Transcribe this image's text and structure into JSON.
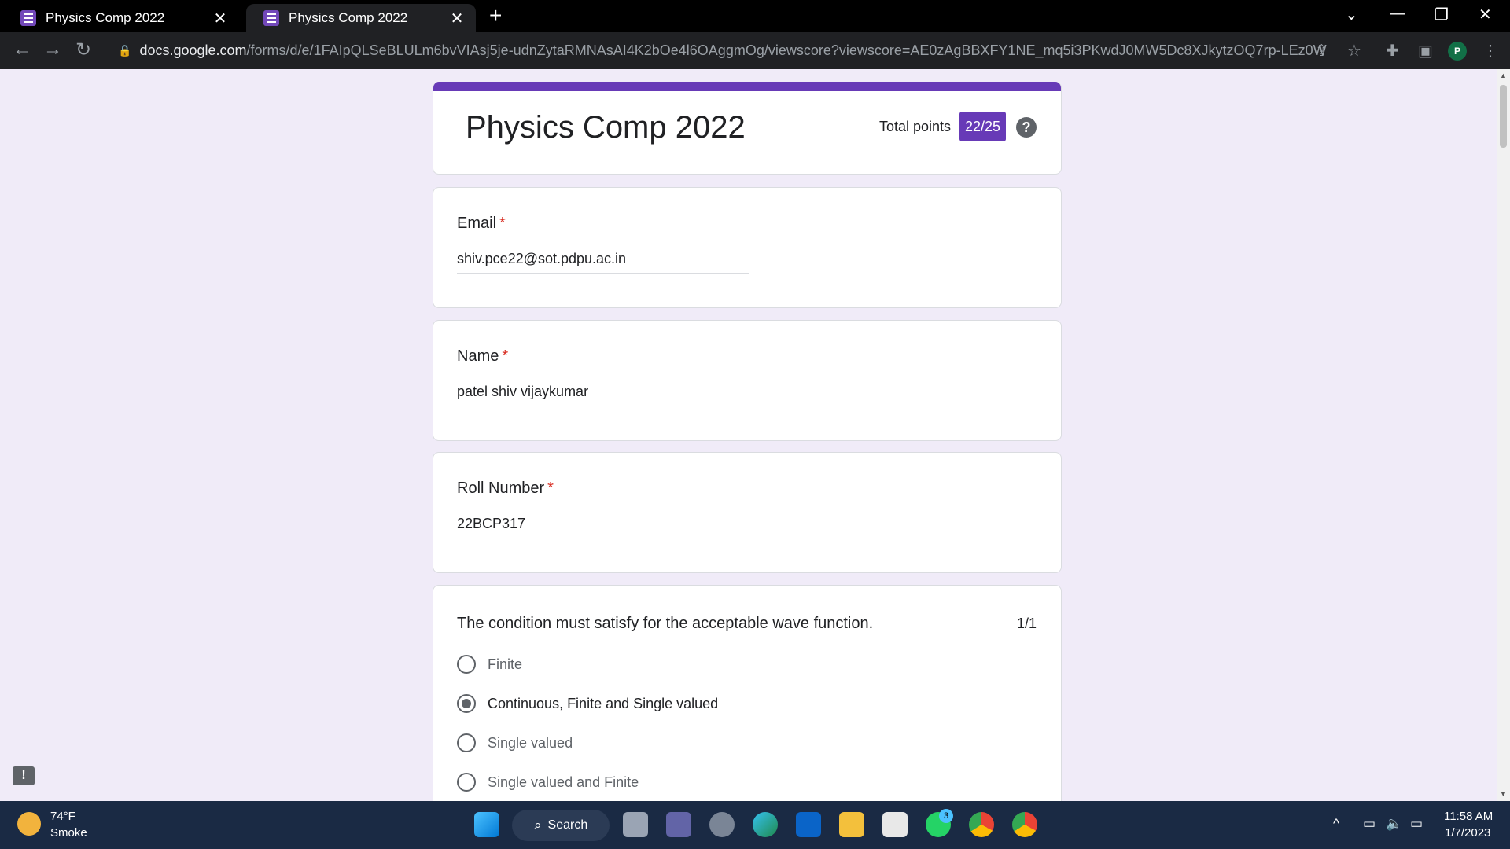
{
  "tabs": [
    {
      "title": "Physics Comp 2022"
    },
    {
      "title": "Physics Comp 2022"
    }
  ],
  "address_bar": {
    "host": "docs.google.com",
    "path": "/forms/d/e/1FAIpQLSeBLULm6bvVIAsj5je-udnZytaRMNAsAI4K2bOe4l6OAggmOg/viewscore?viewscore=AE0zAgBBXFY1NE_mq5i3PKwdJ0MW5Dc8XJkytzOQ7rp-LEz0WFk0Hy..."
  },
  "profile_initial": "P",
  "form": {
    "title": "Physics Comp 2022",
    "total_points_label": "Total points",
    "total_points": "22/25",
    "accent_color": "#673ab7"
  },
  "fields": [
    {
      "label": "Email",
      "required": "*",
      "value": "shiv.pce22@sot.pdpu.ac.in"
    },
    {
      "label": "Name",
      "required": "*",
      "value": "patel shiv vijaykumar"
    },
    {
      "label": "Roll Number",
      "required": "*",
      "value": "22BCP317"
    }
  ],
  "question": {
    "text": "The condition must satisfy for the acceptable wave function.",
    "score": "1/1",
    "options": [
      {
        "label": "Finite",
        "selected": false
      },
      {
        "label": "Continuous, Finite and Single valued",
        "selected": true
      },
      {
        "label": "Single valued",
        "selected": false
      },
      {
        "label": "Single valued and Finite",
        "selected": false
      }
    ]
  },
  "taskbar": {
    "weather_temp": "74°F",
    "weather_condition": "Smoke",
    "search_label": "Search",
    "whatsapp_badge": "3",
    "time": "11:58 AM",
    "date": "1/7/2023"
  }
}
